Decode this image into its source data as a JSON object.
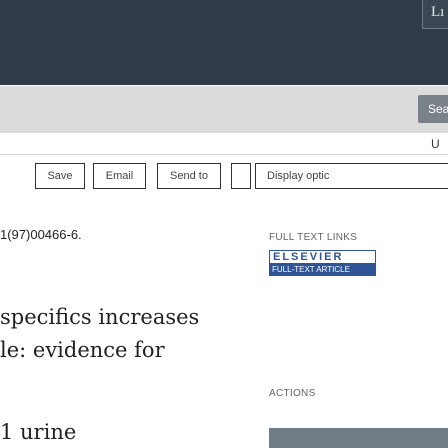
{
  "header": {
    "corner_button_glyph": "Lı"
  },
  "search": {
    "button_label": "Sea",
    "user_link": "U"
  },
  "toolbar": {
    "save_label": "Save",
    "email_label": "Email",
    "send_to_label": "Send to",
    "display_options_label": "Display optic"
  },
  "article": {
    "doi_fragment": "1(97)00466-6.",
    "title_lines": [
      "specifics increases",
      "le: evidence for",
      "1 urine"
    ]
  },
  "sidebar": {
    "full_text_links_label": "FULL TEXT LINKS",
    "publisher_logo_top": "ELSEVIER",
    "publisher_logo_bottom": "FULL-TEXT ARTICLE",
    "actions_label": "ACTIONS"
  },
  "colors": {
    "header_bg": "#2f3b47",
    "search_band_bg": "#dcdcdc",
    "elsevier_blue": "#2f5597",
    "action_bar": "#6f7b85"
  }
}
